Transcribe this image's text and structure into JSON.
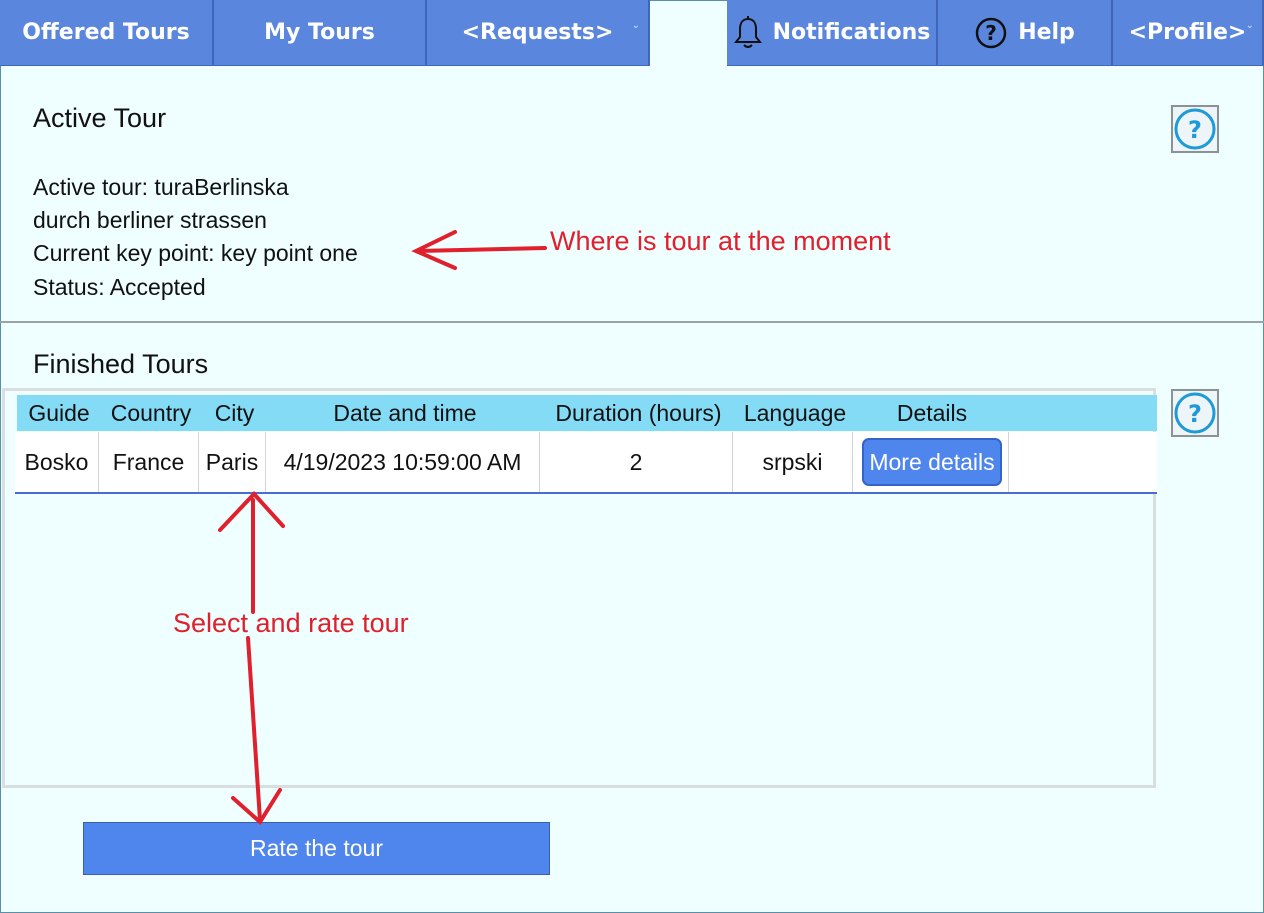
{
  "nav": {
    "offered_tours": "Offered Tours",
    "my_tours": "My Tours",
    "requests": "<Requests>",
    "notifications": "Notifications",
    "help": "Help",
    "profile": "<Profile>"
  },
  "active_tour": {
    "title": "Active Tour",
    "lines": [
      "Active tour: turaBerlinska",
      "durch berliner strassen",
      "Current key point: key point one",
      "Status: Accepted"
    ]
  },
  "finished_tours": {
    "title": "Finished Tours",
    "columns": [
      "Guide",
      "Country",
      "City",
      "Date and time",
      "Duration (hours)",
      "Language",
      "Details"
    ],
    "rows": [
      {
        "guide": "Bosko",
        "country": "France",
        "city": "Paris",
        "date_time": "4/19/2023 10:59:00 AM",
        "duration": "2",
        "language": "srpski",
        "details_button": "More details"
      }
    ]
  },
  "rate_button": "Rate the tour",
  "annotations": {
    "where": "Where is tour at the moment",
    "select": "Select and rate tour"
  },
  "colors": {
    "nav_bg": "#5b86dd",
    "header_bg": "#84dbf6",
    "button_bg": "#4f86ee",
    "annotation": "#e0202c",
    "page_bg": "#effefe"
  }
}
